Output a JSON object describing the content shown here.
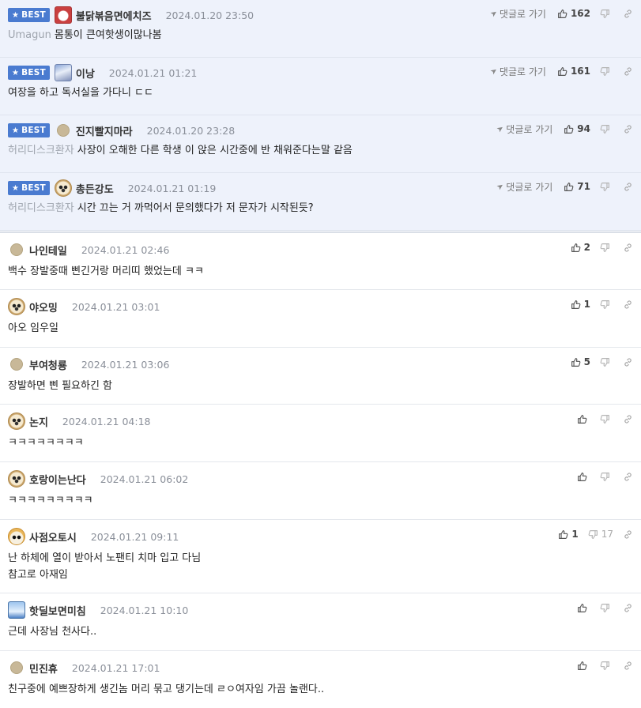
{
  "labels": {
    "best": "BEST",
    "reply": "댓글로 가기"
  },
  "colors": {
    "best_bg": "#eef2fb",
    "badge": "#4a7bd0"
  },
  "best_comments": [
    {
      "avatar": "red-face-icon",
      "nick": "불닭볶음면에치즈",
      "date": "2024.01.20 23:50",
      "quote": "Umagun",
      "text": "몸통이 큰여핫생이많나봄",
      "up": "162"
    },
    {
      "avatar": "anime-girl-icon",
      "nick": "이낭",
      "date": "2024.01.21 01:21",
      "quote": "",
      "text": "여장을 하고 독서실을 가다니 ㄷㄷ",
      "up": "161"
    },
    {
      "avatar": "dot-icon",
      "nick": "진지빨지마라",
      "date": "2024.01.20 23:28",
      "quote": "허리디스크환자",
      "text": "사장이 오해한 다른 학생 이 앉은 시간중에 반 채워준다는말 같음",
      "up": "94"
    },
    {
      "avatar": "puppy-icon",
      "nick": "총든강도",
      "date": "2024.01.21 01:19",
      "quote": "허리디스크환자",
      "text": "시간 끄는 거 까먹어서 문의했다가 저 문자가 시작된듯?",
      "up": "71"
    }
  ],
  "comments": [
    {
      "avatar": "dot-icon",
      "nick": "나인테일",
      "date": "2024.01.21 02:46",
      "text": "백수 장발중때 삔긴거랑 머리띠 했었는데 ㅋㅋ",
      "up": "2",
      "down": ""
    },
    {
      "avatar": "puppy-icon",
      "nick": "야오밍",
      "date": "2024.01.21 03:01",
      "text": "아오 임우일",
      "up": "1",
      "down": ""
    },
    {
      "avatar": "dot-icon",
      "nick": "부여청룡",
      "date": "2024.01.21 03:06",
      "text": "장발하면 삔 필요하긴 함",
      "up": "5",
      "down": ""
    },
    {
      "avatar": "puppy-icon",
      "nick": "논지",
      "date": "2024.01.21 04:18",
      "text": "ㅋㅋㅋㅋㅋㅋㅋㅋ",
      "up": "",
      "down": ""
    },
    {
      "avatar": "puppy-icon",
      "nick": "호랑이는난다",
      "date": "2024.01.21 06:02",
      "text": "ㅋㅋㅋㅋㅋㅋㅋㅋㅋ",
      "up": "",
      "down": ""
    },
    {
      "avatar": "cat-icon",
      "nick": "사점오토시",
      "date": "2024.01.21 09:11",
      "text": "난 하체에 열이 받아서 노팬티 치마 입고 다님\n참고로 아재임",
      "up": "1",
      "down": "17"
    },
    {
      "avatar": "blue-character-icon",
      "nick": "핫딜보면미침",
      "date": "2024.01.21 10:10",
      "text": "근데 사장님 천사다..",
      "up": "",
      "down": ""
    },
    {
      "avatar": "dot-icon",
      "nick": "민진휴",
      "date": "2024.01.21 17:01",
      "text": "친구중에 예쁘장하게 생긴놈 머리 묶고 댕기는데 ㄹㅇ여자임 가끔 놀랜다..",
      "up": "",
      "down": ""
    }
  ]
}
